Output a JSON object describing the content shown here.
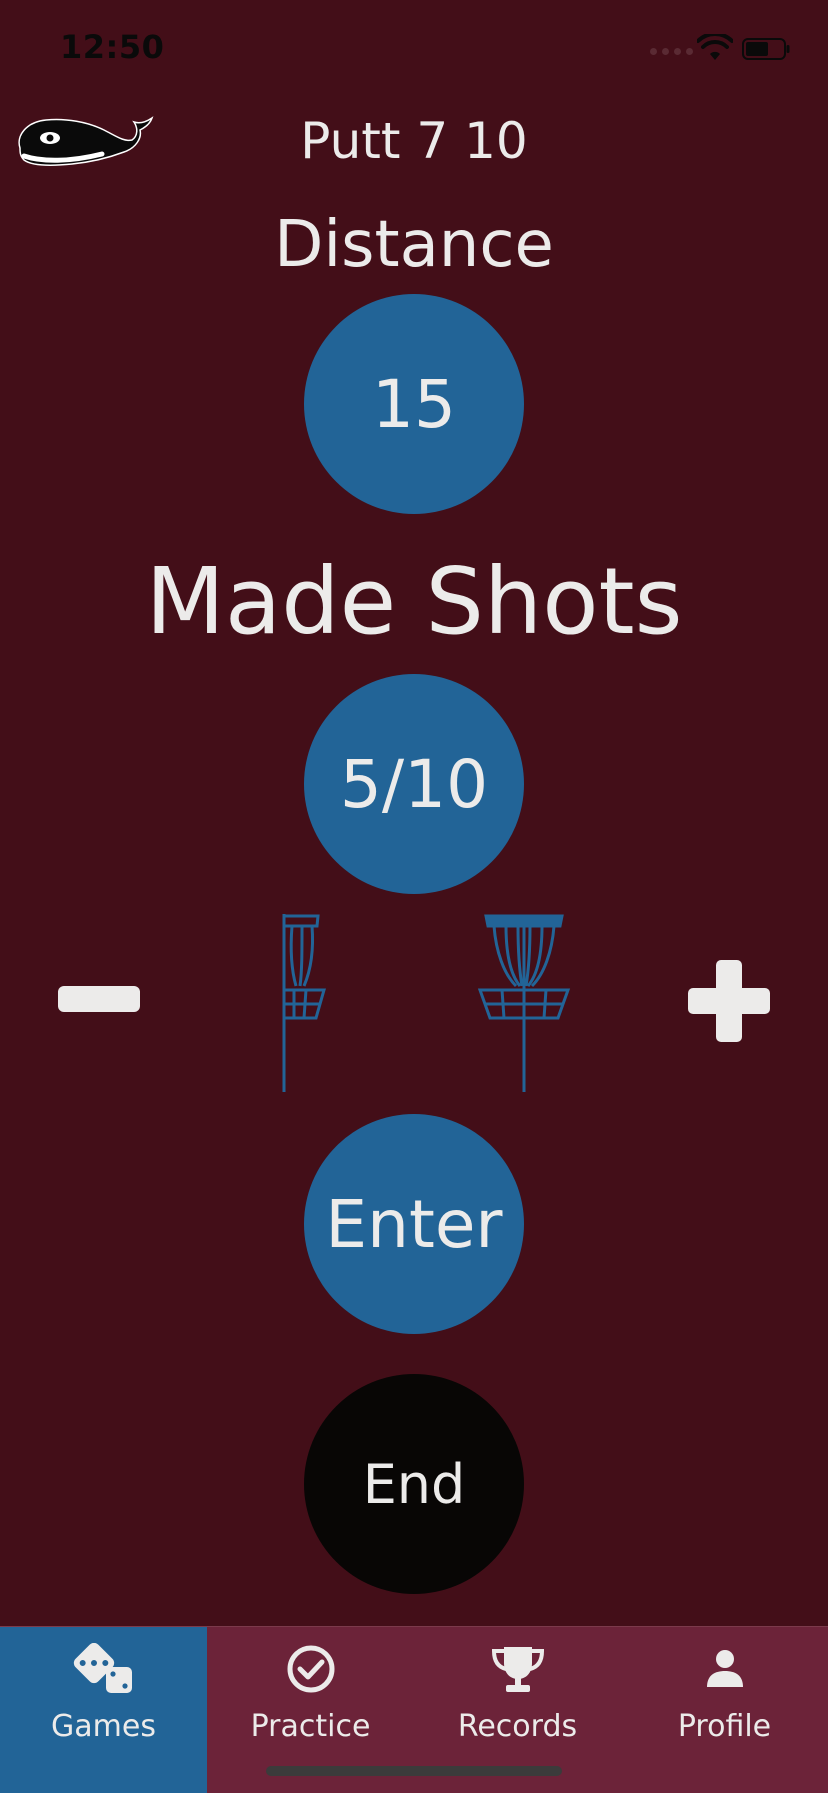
{
  "status_bar": {
    "time": "12:50",
    "wifi_icon": "wifi-icon",
    "battery_icon": "battery-icon",
    "signal_icon": "signal-dots-icon"
  },
  "header": {
    "logo_icon": "whale-icon",
    "title": "Putt 7 10"
  },
  "distance": {
    "label": "Distance",
    "value": "15"
  },
  "made_shots": {
    "label": "Made Shots",
    "value": "5/10"
  },
  "counter": {
    "decrease_icon": "minus-icon",
    "increase_icon": "plus-icon",
    "basket_icon": "disc-golf-basket-icon"
  },
  "actions": {
    "enter_label": "Enter",
    "end_label": "End"
  },
  "tabs": [
    {
      "label": "Games",
      "icon": "dice-icon",
      "active": true
    },
    {
      "label": "Practice",
      "icon": "check-circle-icon",
      "active": false
    },
    {
      "label": "Records",
      "icon": "trophy-icon",
      "active": false
    },
    {
      "label": "Profile",
      "icon": "person-icon",
      "active": false
    }
  ],
  "colors": {
    "background": "#430e18",
    "circle_blue": "#226497",
    "end_black": "#080605",
    "tabbar": "#6c2339",
    "text": "#ecebea"
  }
}
